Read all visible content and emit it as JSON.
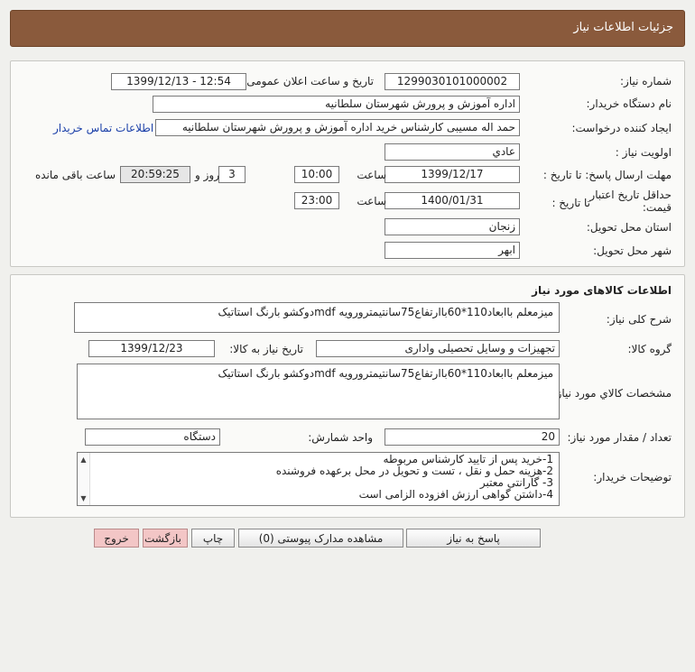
{
  "header": {
    "title": "جزئیات اطلاعات نیاز"
  },
  "info": {
    "need_number_label": "شماره نیاز:",
    "need_number": "1299030101000002",
    "announce_label": "تاریخ و ساعت اعلان عمومی:",
    "announce_value": "1399/12/13 - 12:54",
    "buyer_org_label": "نام دستگاه خریدار:",
    "buyer_org": "اداره آموزش و پرورش شهرستان سلطانیه",
    "requester_label": "ایجاد کننده درخواست:",
    "requester": "حمد اله مسیبی کارشناس خرید اداره آموزش و پرورش شهرستان سلطانیه",
    "contact_link": "اطلاعات تماس خریدار",
    "priority_label": "اولویت نیاز :",
    "priority": "عادي",
    "deadline_label": "مهلت ارسال پاسخ: تا تاریخ :",
    "deadline_date": "1399/12/17",
    "time_label": "ساعت",
    "deadline_time": "10:00",
    "days_count": "3",
    "days_label": "روز و",
    "remaining_time": "20:59:25",
    "remaining_label": "ساعت باقی مانده",
    "validity_label_1": "حداقل تاریخ اعتبار",
    "validity_label_2": "قیمت:",
    "validity_to_label": "تا تاریخ :",
    "validity_date": "1400/01/31",
    "validity_time_label": "ساعت",
    "validity_time": "23:00",
    "province_label": "استان محل تحویل:",
    "province": "زنجان",
    "city_label": "شهر محل تحویل:",
    "city": "ابهر"
  },
  "goods": {
    "section_title": "اطلاعات کالاهای مورد نیاز",
    "description_label": "شرح کلی نیاز:",
    "description": "میزمعلم باابعاد110*60باارتفاع75سانتیمترورویه mdfدوکشو بارنگ استاتیک",
    "group_label": "گروه کالا:",
    "group": "تجهیزات و وسایل تحصیلی واداری",
    "need_date_label": "تاریخ نیاز به کالا:",
    "need_date": "1399/12/23",
    "specs_label": "مشخصات كالاي مورد نياز:",
    "specs": "میزمعلم باابعاد110*60باارتفاع75سانتیمترورویه mdfدوکشو بارنگ استاتیک",
    "qty_label": "تعداد / مقدار مورد نیاز:",
    "qty": "20",
    "unit_label": "واحد شمارش:",
    "unit": "دستگاه",
    "notes_label": "توضیحات خریدار:",
    "notes": [
      "1-خرید پس  از تایید کارشناس مربوطه",
      "2-هزینه حمل و نقل ، تست و تحویل در محل برعهده فروشنده",
      "3- گارانتی معتبر",
      "4-داشتن گواهی ارزش افزوده الزامی است"
    ]
  },
  "buttons": {
    "reply": "پاسخ به نیاز",
    "attachments": "مشاهده مدارک پیوستی (0)",
    "print": "چاپ",
    "back": "بازگشت",
    "exit": "خروج"
  }
}
